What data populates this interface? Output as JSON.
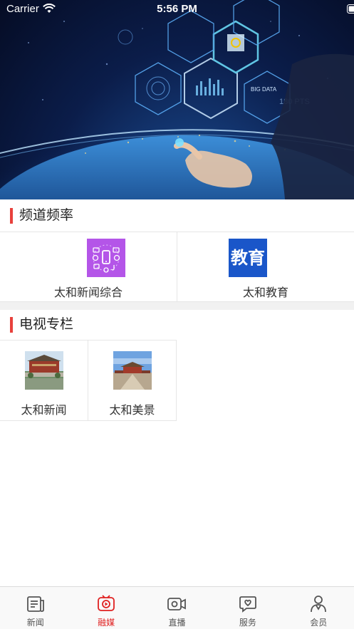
{
  "status_bar": {
    "carrier": "Carrier",
    "time": "5:56 PM"
  },
  "hero": {
    "overlay_texts": [
      "BIG DATA",
      "180 PTS"
    ]
  },
  "channel_section": {
    "title": "频道频率",
    "items": [
      {
        "label": "太和新闻综合",
        "icon": "media-apps-icon"
      },
      {
        "label": "太和教育",
        "icon_text": "教育"
      }
    ]
  },
  "tv_section": {
    "title": "电视专栏",
    "items": [
      {
        "label": "太和新闻",
        "icon": "palace-photo"
      },
      {
        "label": "太和美景",
        "icon": "palace-square-photo"
      }
    ]
  },
  "tabbar": {
    "items": [
      {
        "label": "新闻",
        "icon": "newspaper-icon",
        "active": false
      },
      {
        "label": "融媒",
        "icon": "media-play-icon",
        "active": true
      },
      {
        "label": "直播",
        "icon": "video-camera-icon",
        "active": false
      },
      {
        "label": "服务",
        "icon": "heart-message-icon",
        "active": false
      },
      {
        "label": "会员",
        "icon": "user-icon",
        "active": false
      }
    ],
    "active_color": "#e02020",
    "inactive_color": "#555555"
  },
  "colors": {
    "accent": "#e8413c",
    "education_blue": "#1a56c9",
    "media_purple": "#b455e8"
  }
}
